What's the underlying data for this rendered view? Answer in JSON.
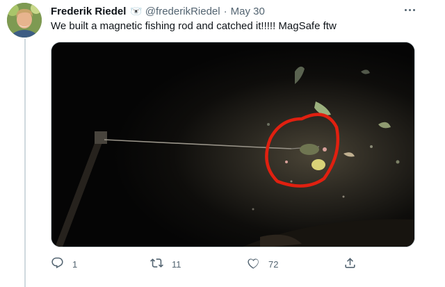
{
  "tweet": {
    "author_name": "Frederik Riedel",
    "author_badge": "🐻‍❄️",
    "handle": "@frederikRiedel",
    "separator": "·",
    "date": "May 30",
    "text": "We built a magnetic fishing rod and catched it!!!!! MagSafe ftw"
  },
  "actions": {
    "reply_count": "1",
    "retweet_count": "11",
    "like_count": "72"
  },
  "colors": {
    "text_primary": "#0f1419",
    "text_secondary": "#536471",
    "highlight_circle": "#e02010"
  },
  "icons": [
    "reply-icon",
    "retweet-icon",
    "like-icon",
    "share-icon",
    "more-icon"
  ]
}
